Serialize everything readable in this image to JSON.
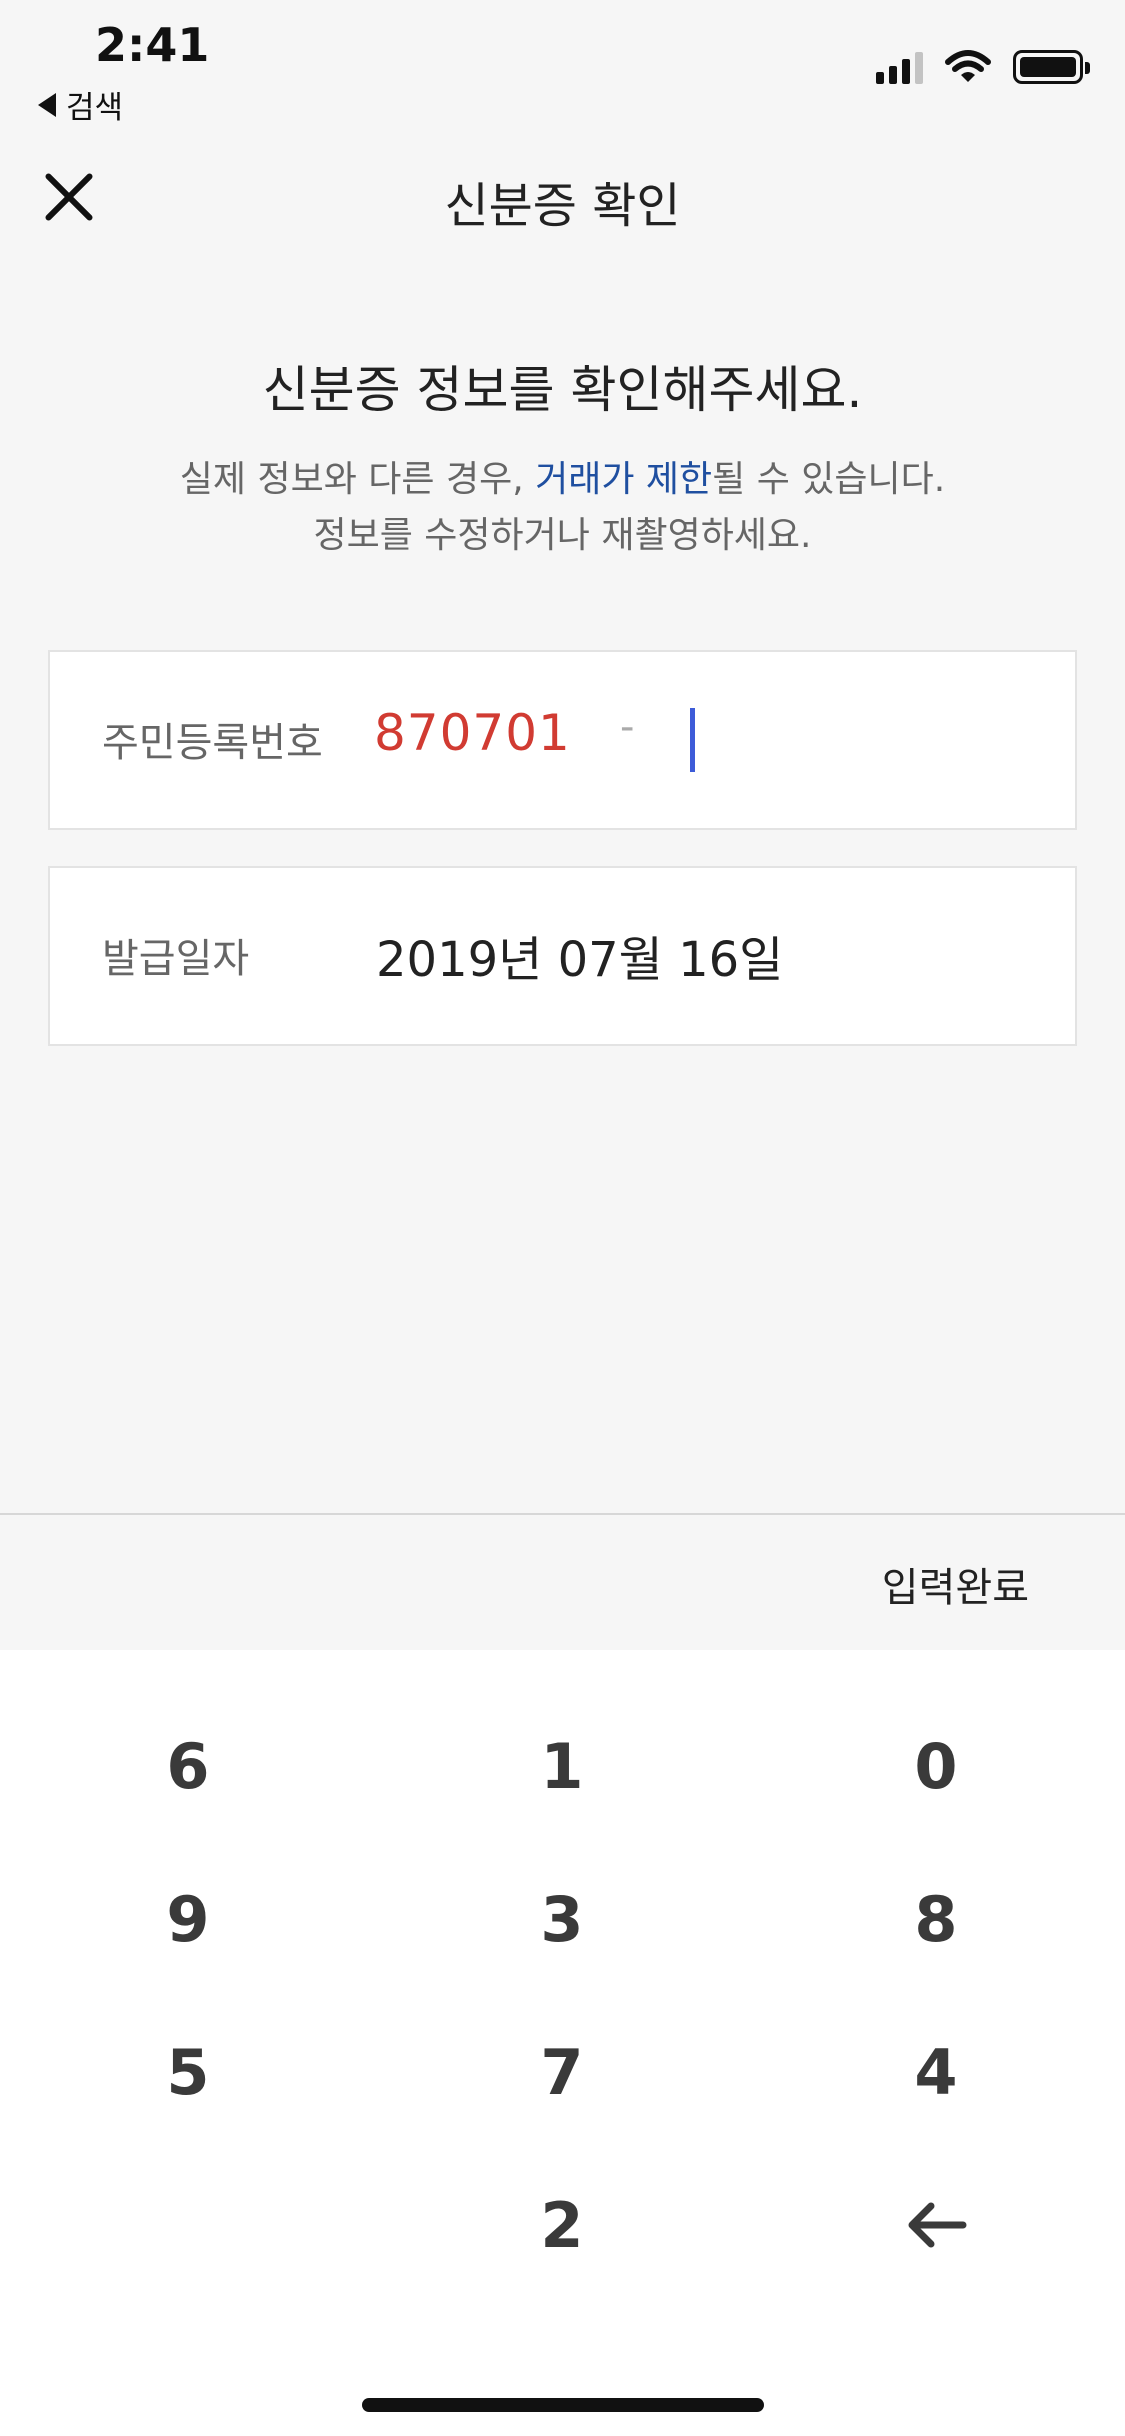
{
  "status_bar": {
    "time": "2:41",
    "back_label": "검색"
  },
  "header": {
    "title": "신분증 확인"
  },
  "content": {
    "heading": "신분증 정보를 확인해주세요.",
    "desc_before_link": "실제 정보와 다른 경우, ",
    "desc_link": "거래가 제한",
    "desc_after_link": "될 수 있습니다.",
    "desc_line2": "정보를 수정하거나 재촬영하세요."
  },
  "fields": {
    "rrn_label": "주민등록번호",
    "rrn_front": "870701",
    "rrn_separator": "-",
    "issue_label": "발급일자",
    "issue_date": "2019년 07월 16일"
  },
  "toolbar": {
    "done_label": "입력완료"
  },
  "keypad": {
    "row1": [
      "6",
      "1",
      "0"
    ],
    "row2": [
      "9",
      "3",
      "8"
    ],
    "row3": [
      "5",
      "7",
      "4"
    ],
    "row4": [
      "",
      "2",
      "backspace"
    ]
  },
  "colors": {
    "accent_link": "#1f4fa0",
    "value_error": "#d13b32",
    "cursor": "#3d5bd8"
  }
}
